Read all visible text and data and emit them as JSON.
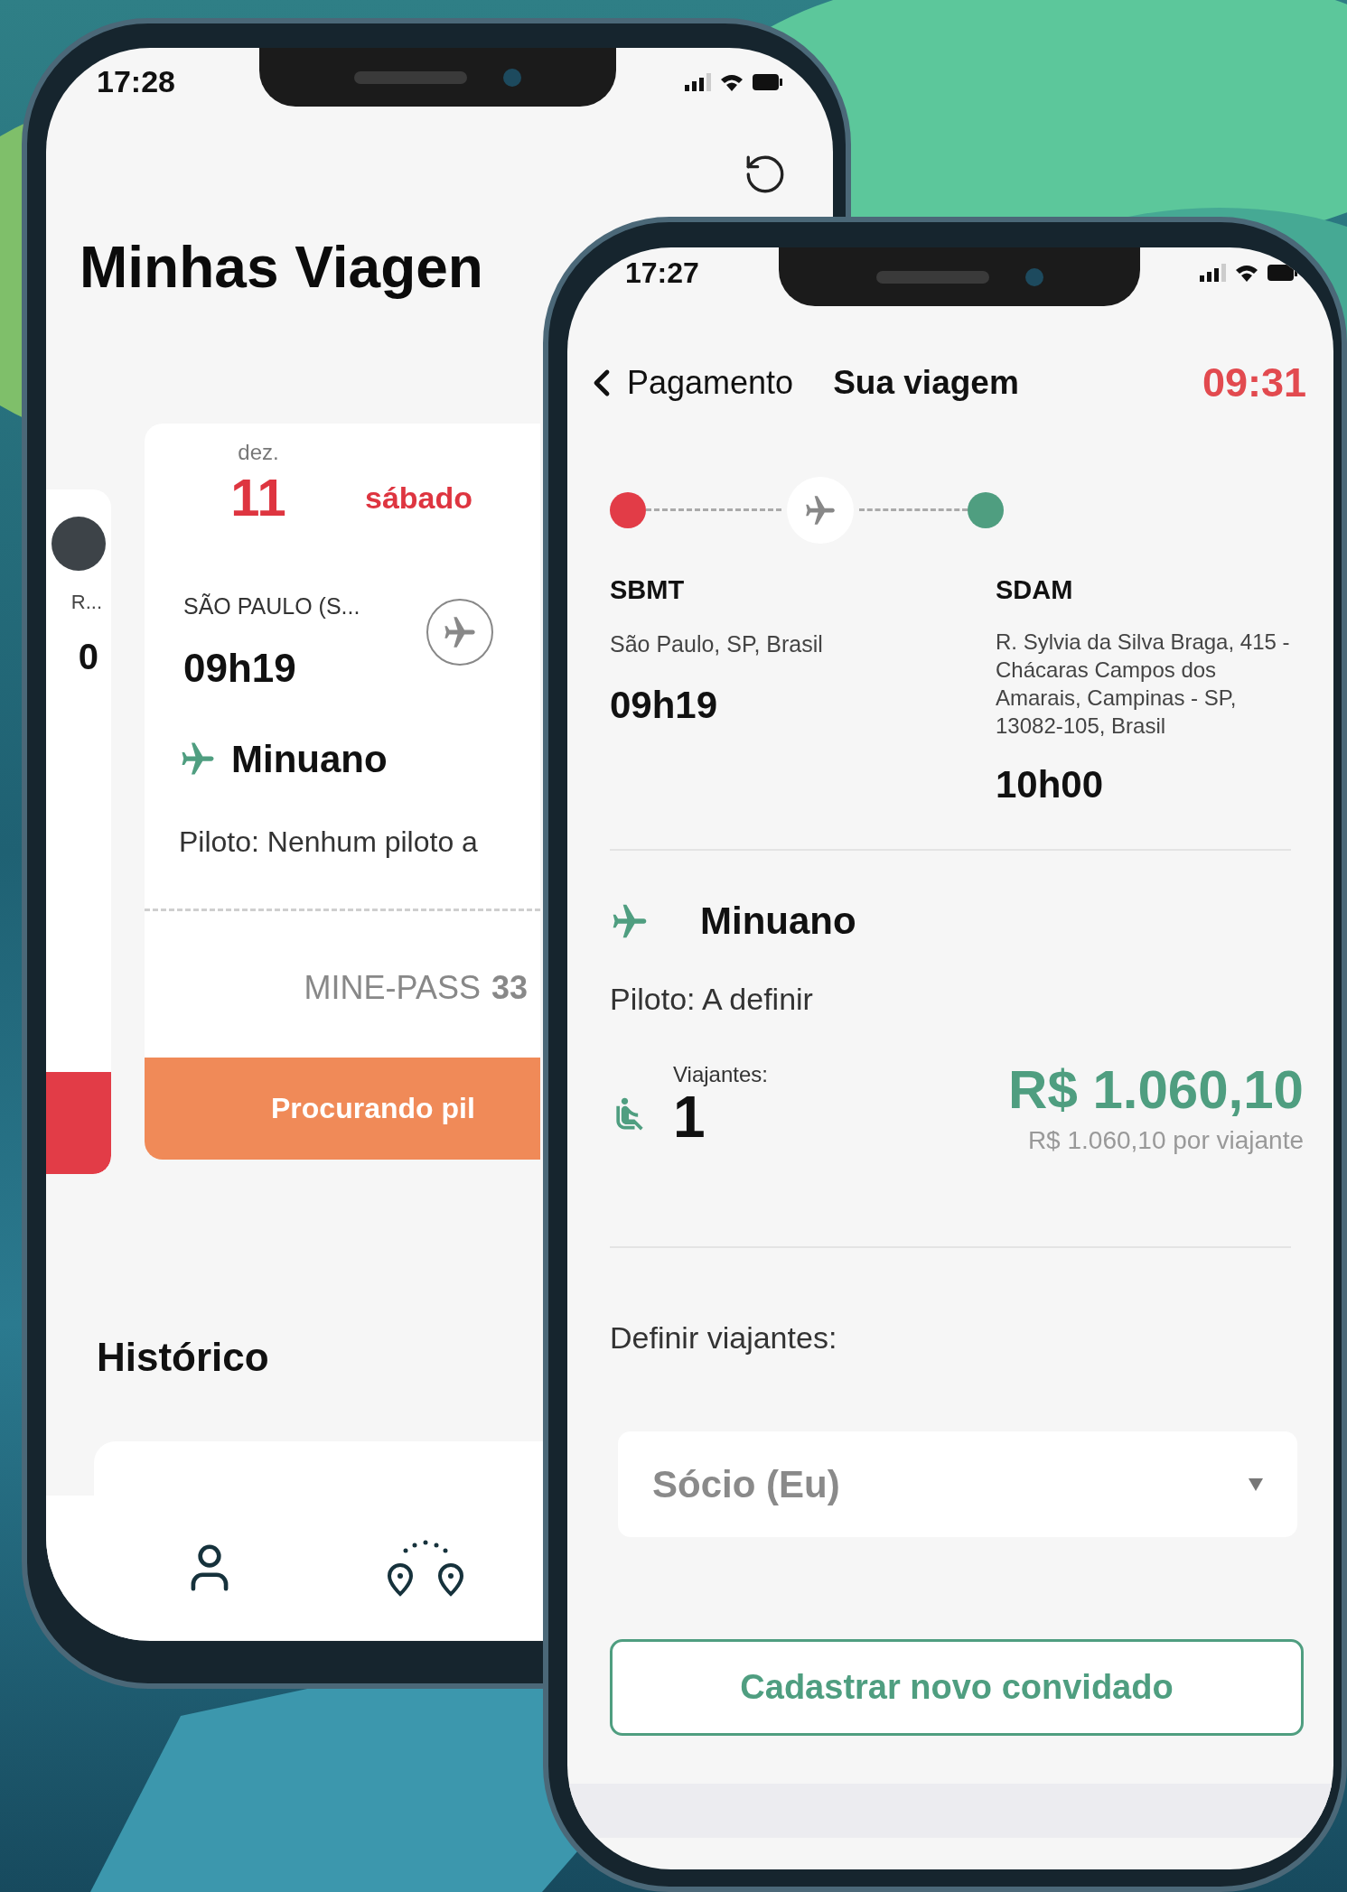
{
  "trips_screen": {
    "status_time": "17:28",
    "title": "Minhas Viagen",
    "previous_card": {
      "line_1": "R...",
      "line_2": "0"
    },
    "trip_card": {
      "month": "dez.",
      "day": "11",
      "weekday": "sábado",
      "origin": "SÃO PAULO (S...",
      "departure": "09h19",
      "aircraft": "Minuano",
      "pilot": "Piloto: Nenhum piloto a",
      "pass_label": "MINE-PASS",
      "pass_number": "33",
      "status": "Procurando pil"
    },
    "history_title": "Histórico"
  },
  "payment_screen": {
    "status_time": "17:27",
    "back_label": "Pagamento",
    "title": "Sua viagem",
    "countdown": "09:31",
    "origin": {
      "code": "SBMT",
      "address": "São Paulo, SP, Brasil",
      "time": "09h19"
    },
    "destination": {
      "code": "SDAM",
      "address": "R. Sylvia da Silva Braga, 415 - Chácaras Campos dos Amarais, Campinas - SP, 13082-105, Brasil",
      "time": "10h00"
    },
    "aircraft": "Minuano",
    "pilot": "Piloto: A definir",
    "travelers_label": "Viajantes:",
    "travelers_count": "1",
    "price": "R$ 1.060,10",
    "price_per_traveler": "R$ 1.060,10 por viajante",
    "define_label": "Definir viajantes:",
    "traveler_select": {
      "value": "Sócio (Eu)"
    },
    "add_guest_button": "Cadastrar novo convidado"
  }
}
